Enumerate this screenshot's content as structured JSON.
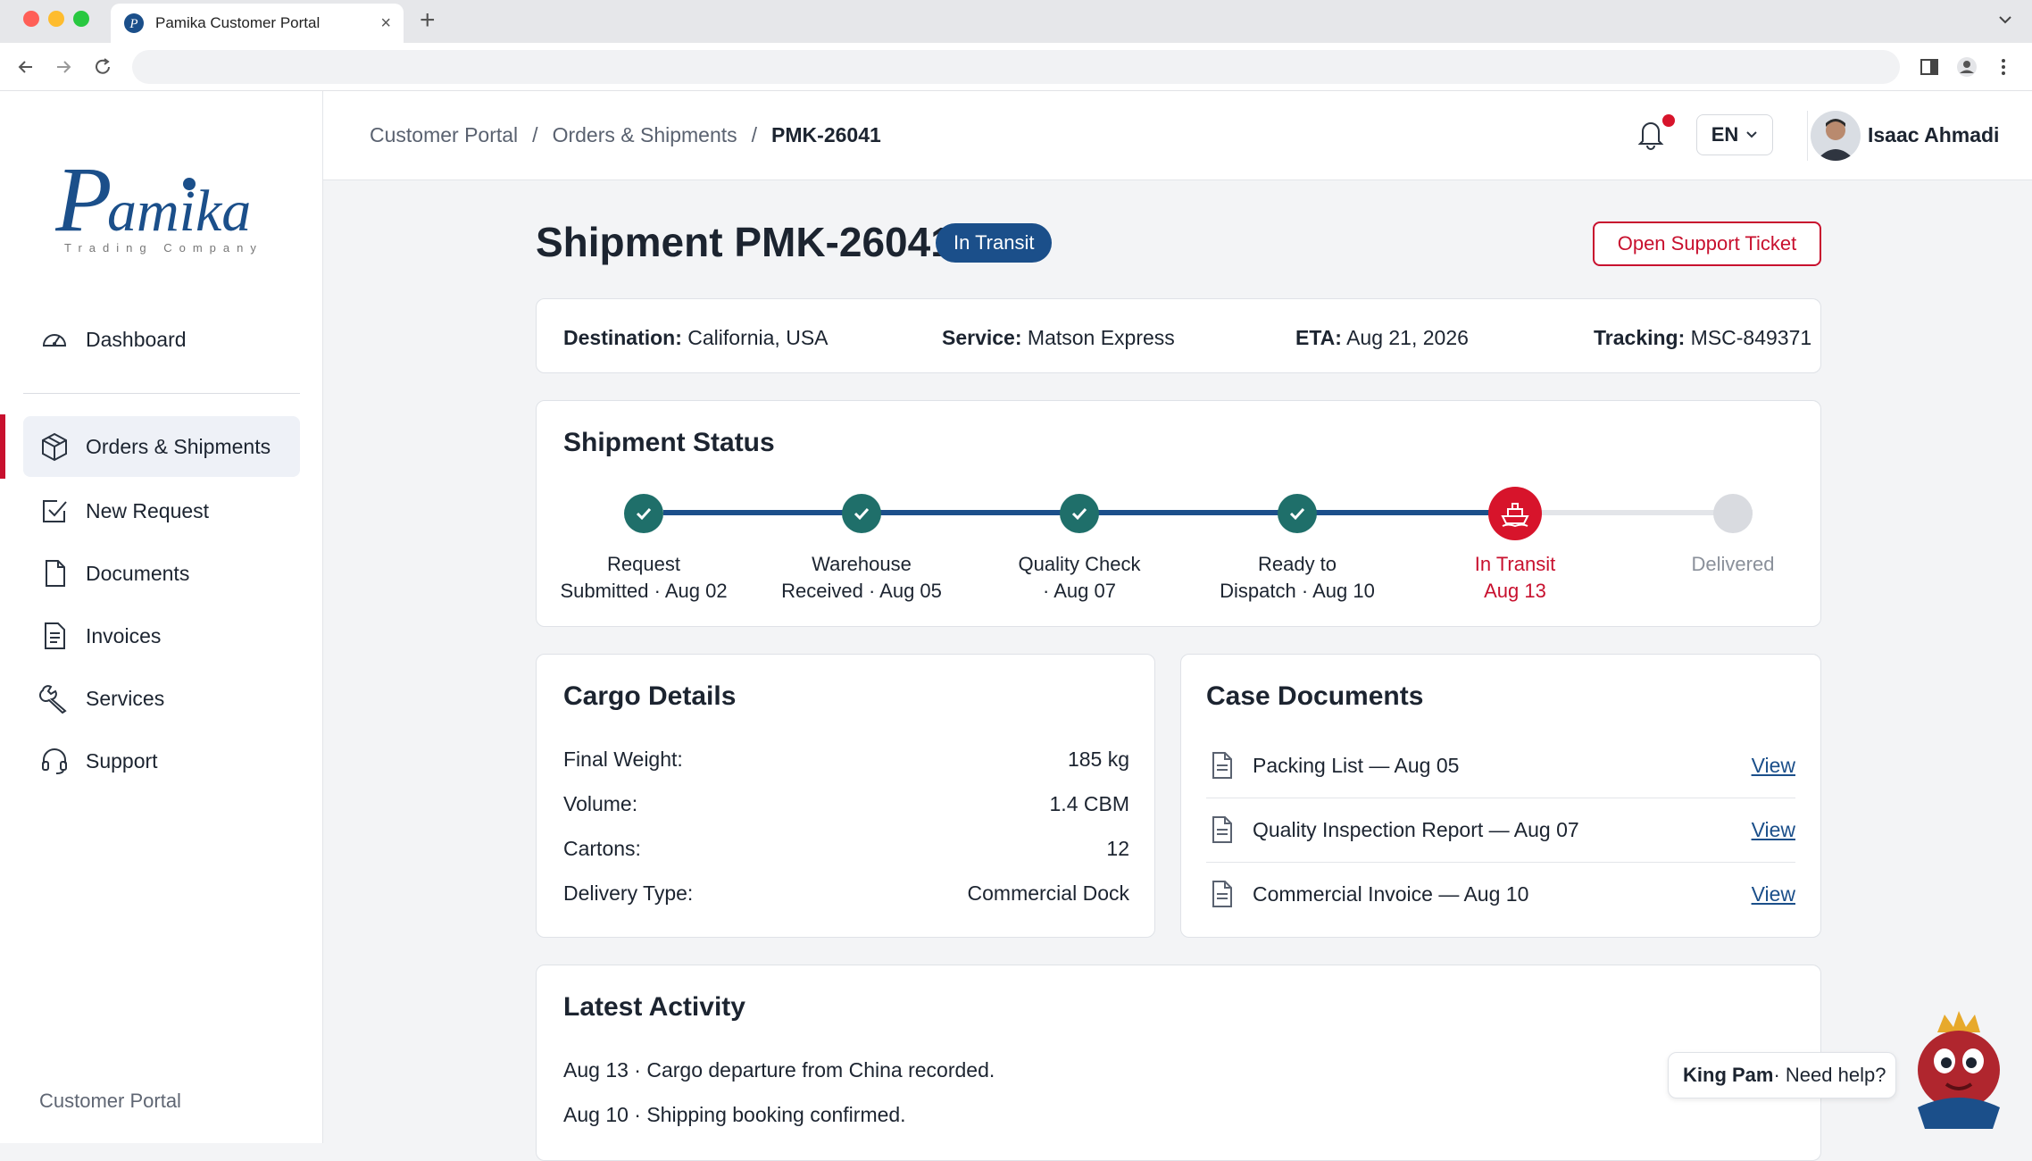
{
  "browser": {
    "tab_title": "Pamika Customer Portal",
    "tab_close": "×",
    "new_tab": "+"
  },
  "sidebar": {
    "logo_text": "Pamika",
    "logo_subtext": "Trading Company",
    "items": [
      {
        "label": "Dashboard",
        "icon": "gauge-icon"
      },
      {
        "label": "Orders & Shipments",
        "icon": "package-icon",
        "active": true
      },
      {
        "label": "New Request",
        "icon": "checkbox-icon"
      },
      {
        "label": "Documents",
        "icon": "document-icon"
      },
      {
        "label": "Invoices",
        "icon": "invoice-icon"
      },
      {
        "label": "Services",
        "icon": "wrench-icon"
      },
      {
        "label": "Support",
        "icon": "headset-icon"
      }
    ],
    "footer": "Customer Portal"
  },
  "header": {
    "breadcrumb": [
      "Customer Portal",
      "/",
      "Orders & Shipments",
      "/",
      "PMK-26041"
    ],
    "language": "EN",
    "user_name": "Isaac Ahmadi"
  },
  "shipment": {
    "title": "Shipment PMK-26041",
    "status_badge": "In Transit",
    "support_button": "Open Support Ticket",
    "summary": {
      "destination_label": "Destination:",
      "destination": "California, USA",
      "service_label": "Service:",
      "service": "Matson Express",
      "eta_label": "ETA:",
      "eta": "Aug 21, 2026",
      "tracking_label": "Tracking:",
      "tracking": "MSC-849371"
    }
  },
  "status": {
    "title": "Shipment Status",
    "steps": [
      {
        "label": "Request\nSubmitted · Aug 02",
        "state": "done"
      },
      {
        "label": "Warehouse\nReceived · Aug 05",
        "state": "done"
      },
      {
        "label": "Quality Check\n· Aug 07",
        "state": "done"
      },
      {
        "label": "Ready to\nDispatch · Aug 10",
        "state": "done"
      },
      {
        "label": "In Transit\nAug 13",
        "state": "current"
      },
      {
        "label": "Delivered",
        "state": "pending"
      }
    ],
    "colors": {
      "done": "#1f6f6a",
      "line": "#1b4f8a",
      "current": "#d7142b",
      "pending": "#d9dbe0"
    }
  },
  "cargo": {
    "title": "Cargo Details",
    "rows": [
      {
        "label": "Final Weight:",
        "value": "185 kg"
      },
      {
        "label": "Volume:",
        "value": "1.4 CBM"
      },
      {
        "label": "Cartons:",
        "value": "12"
      },
      {
        "label": "Delivery Type:",
        "value": "Commercial Dock"
      }
    ]
  },
  "documents": {
    "title": "Case Documents",
    "items": [
      {
        "name": "Packing List — Aug 05",
        "action": "View"
      },
      {
        "name": "Quality Inspection Report — Aug 07",
        "action": "View"
      },
      {
        "name": "Commercial Invoice — Aug 10",
        "action": "View"
      }
    ]
  },
  "activity": {
    "title": "Latest Activity",
    "items": [
      "Aug 13 · Cargo departure from China recorded.",
      "Aug 10 · Shipping booking confirmed."
    ]
  },
  "helper": {
    "name": "King Pam",
    "text": " · Need help?"
  }
}
